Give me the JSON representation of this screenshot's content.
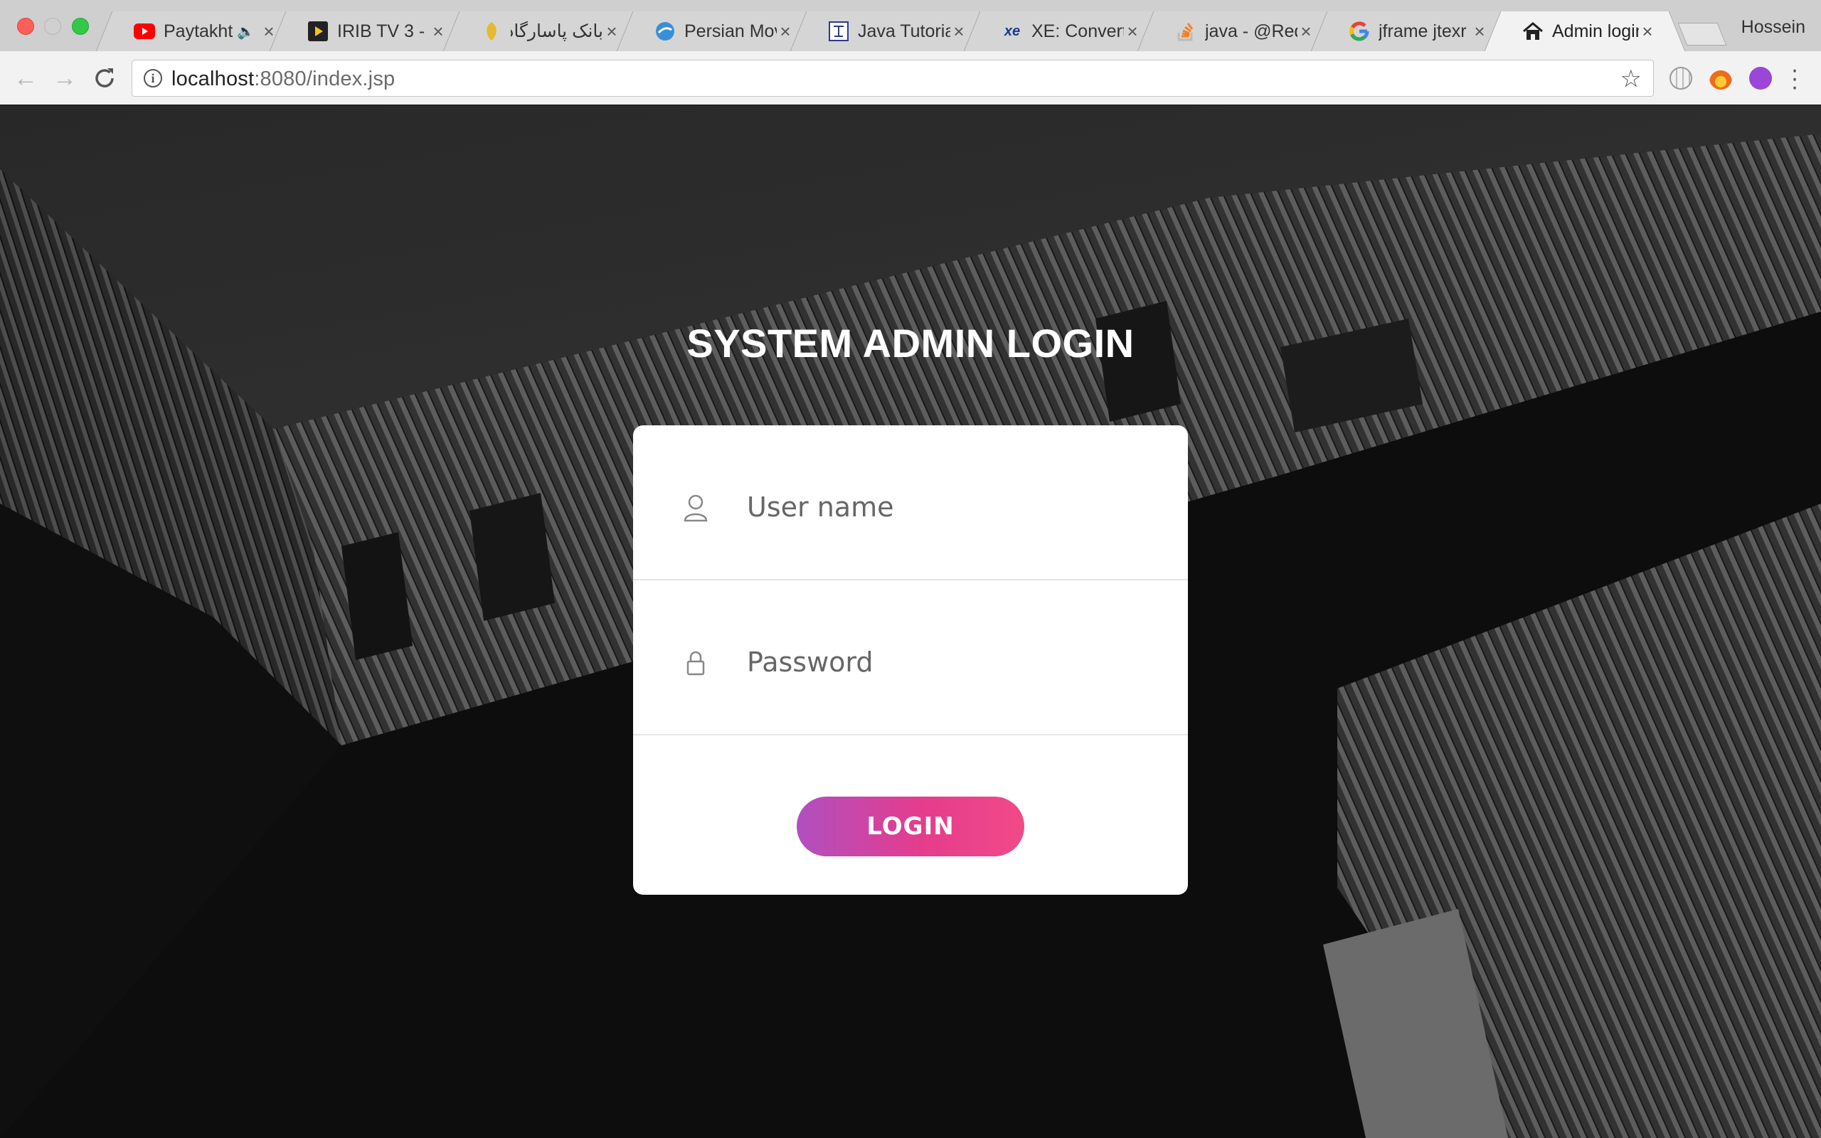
{
  "browser": {
    "tabs": [
      {
        "title": "Paytakht",
        "favicon": "youtube-icon",
        "audio": true
      },
      {
        "title": "IRIB TV 3 - ",
        "favicon": "play-icon"
      },
      {
        "title": "بانک پاسارگاد ::",
        "favicon": "bank-icon"
      },
      {
        "title": "Persian Mov",
        "favicon": "globe-blue-icon"
      },
      {
        "title": "Java Tutoria",
        "favicon": "tutorial-icon"
      },
      {
        "title": "XE: Convert",
        "favicon": "xe-icon"
      },
      {
        "title": "java - @Req",
        "favicon": "stackoverflow-icon"
      },
      {
        "title": "jframe jtexr",
        "favicon": "google-icon"
      },
      {
        "title": "Admin login",
        "favicon": "home-icon",
        "active": true
      }
    ],
    "close_glyph": "×",
    "profile_name": "Hossein",
    "url_host": "localhost",
    "url_rest": ":8080/index.jsp"
  },
  "login": {
    "title": "SYSTEM ADMIN LOGIN",
    "username_placeholder": "User name",
    "password_placeholder": "Password",
    "button_label": "LOGIN"
  },
  "colors": {
    "button_gradient_start": "#b04fc0",
    "button_gradient_end": "#f14a88",
    "card_background": "#ffffff"
  }
}
